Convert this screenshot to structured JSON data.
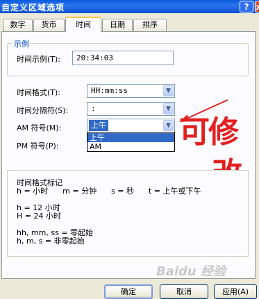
{
  "window": {
    "title": "自定义区域选项",
    "help_icon": "?",
    "close_icon": "x"
  },
  "tabs": [
    "数字",
    "货币",
    "时间",
    "日期",
    "排序"
  ],
  "sample_group": {
    "title": "示例",
    "label": "时间示例(T):",
    "value": "20:34:03"
  },
  "fields": {
    "time_format": {
      "label": "时间格式(T):",
      "value": "HH:mm:ss"
    },
    "separator": {
      "label": "时间分隔符(S):",
      "value": ":"
    },
    "am_symbol": {
      "label": "AM 符号(M):",
      "value": "上午",
      "options": [
        "上午",
        "AM"
      ]
    },
    "pm_symbol": {
      "label": "PM 符号(P):"
    }
  },
  "notes": {
    "title": "时间格式标记",
    "line1": "h = 小时      m = 分钟      s = 秒      t = 上午或下午",
    "line2": "h = 12 小时",
    "line3": "H = 24 小时",
    "line4": "hh, mm, ss = 零起始",
    "line5": "h, m, s = 非零起始"
  },
  "annotation": {
    "line1": "可修",
    "line2": "改",
    "color": "#e32020"
  },
  "buttons": {
    "ok": "确定",
    "cancel": "取消",
    "apply": "应用(A)"
  },
  "watermark": "Baidu 经验"
}
